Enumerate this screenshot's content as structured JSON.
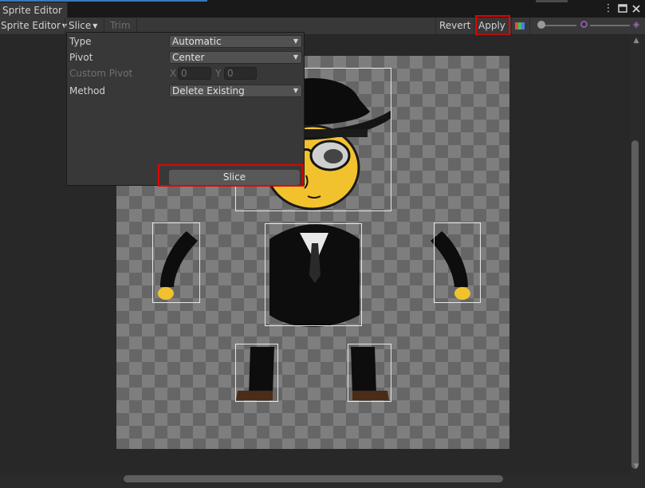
{
  "window": {
    "tab_title": "Sprite Editor",
    "icons": [
      "kebab-menu-icon",
      "maximize-icon",
      "close-icon"
    ]
  },
  "toolbar": {
    "mode_dropdown": "Sprite Editor",
    "slice_menu": "Slice",
    "trim_label": "Trim",
    "revert_label": "Revert",
    "apply_label": "Apply",
    "rgb_toggle_colors": [
      "#e14b4b",
      "#3fbf5f",
      "#4b7be1"
    ],
    "highlight_color": "#e60000"
  },
  "slice_popup": {
    "type_label": "Type",
    "type_value": "Automatic",
    "pivot_label": "Pivot",
    "pivot_value": "Center",
    "custom_pivot_label": "Custom Pivot",
    "x_label": "X",
    "x_value": "0",
    "y_label": "Y",
    "y_value": "0",
    "method_label": "Method",
    "method_value": "Delete Existing",
    "slice_button": "Slice"
  },
  "sprite_sheet": {
    "sprites": [
      "head",
      "body",
      "left-arm",
      "right-arm",
      "left-leg",
      "right-leg"
    ],
    "colors": {
      "skin": "#f2c22e",
      "suit": "#111111",
      "shirt": "#e8e8e8",
      "shoe": "#4a2c18"
    }
  }
}
